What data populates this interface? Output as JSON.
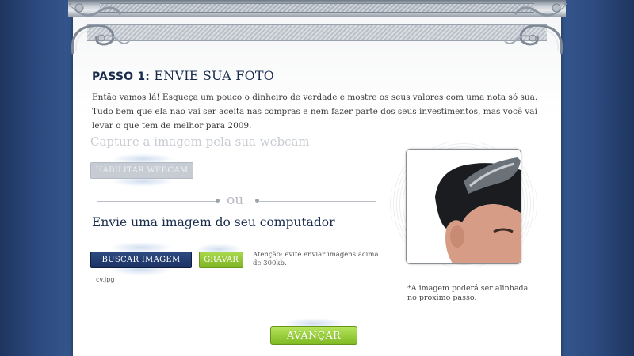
{
  "step": {
    "label": "PASSO 1:",
    "title": "ENVIE SUA FOTO",
    "intro": "Então vamos lá! Esqueça um pouco o dinheiro de verdade e mostre os seus valores com uma nota só sua. Tudo bem que ela não vai ser aceita nas compras e nem fazer parte dos seus investimentos, mas você vai levar o que tem de melhor para 2009."
  },
  "webcam": {
    "title": "Capture a imagem pela sua webcam",
    "button_label": "HABILITAR WEBCAM"
  },
  "divider": {
    "text": "ou"
  },
  "upload": {
    "title": "Envie uma imagem do seu computador",
    "browse_label": "BUSCAR IMAGEM",
    "save_label": "GRAVAR",
    "file_name": "cv.jpg",
    "warning": "Atenção: evite enviar imagens acima de 300kb."
  },
  "photo": {
    "note": "*A imagem poderá ser alinhada no próximo passo."
  },
  "next_label": "AVANÇAR",
  "colors": {
    "background_blue": "#34558c",
    "title_navy": "#1a2c4e",
    "browse_button": "#1c3364",
    "green_button": "#8cc63f",
    "disabled_button": "#c7ccd4"
  },
  "icons": [
    "ornament-scroll-icon",
    "ornament-swirl-icon"
  ]
}
